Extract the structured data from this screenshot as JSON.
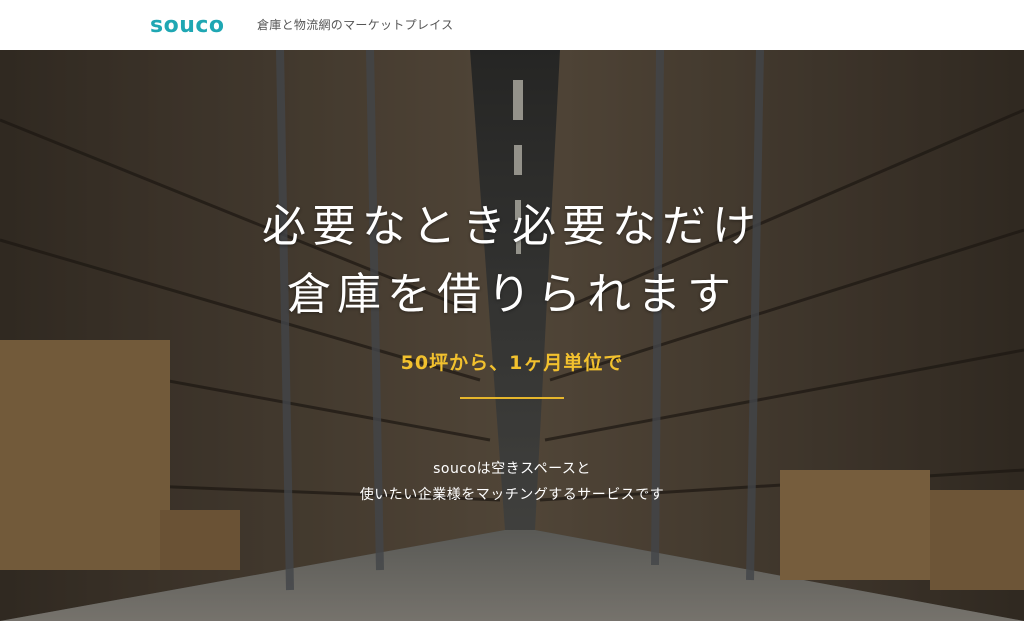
{
  "header": {
    "logo": "souco",
    "tagline": "倉庫と物流網のマーケットプレイス"
  },
  "hero": {
    "headline_line1": "必要なとき必要なだけ",
    "headline_line2": "倉庫を借りられます",
    "accent": "50坪から、1ヶ月単位で",
    "description_line1": "soucoは空きスペースと",
    "description_line2": "使いたい企業様をマッチングするサービスです"
  },
  "colors": {
    "brand": "#1fa7b3",
    "accent": "#f2c12e"
  }
}
